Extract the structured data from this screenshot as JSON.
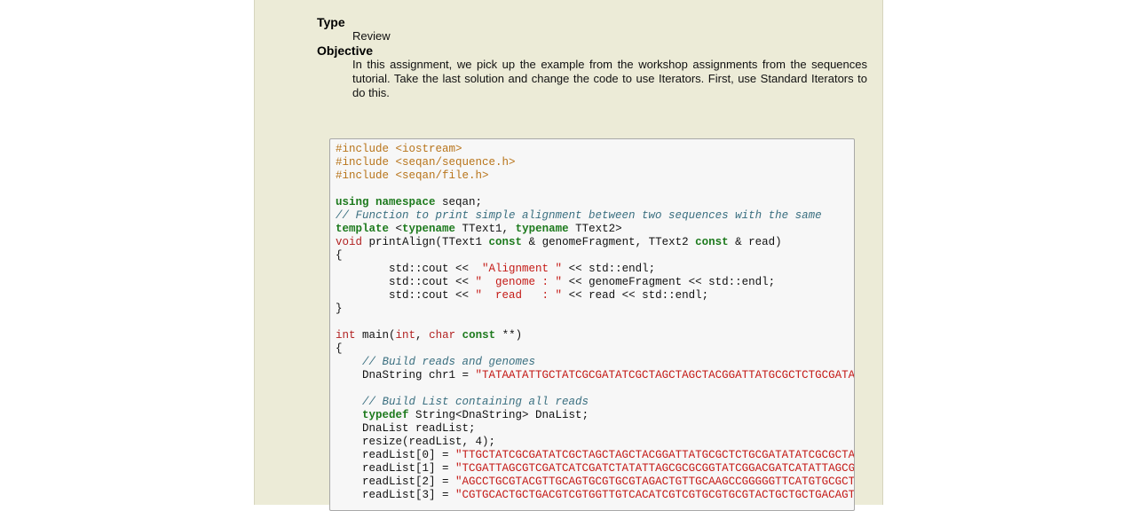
{
  "meta": {
    "type_label": "Type",
    "type_value": "Review",
    "objective_label": "Objective",
    "objective_text": "In this assignment, we pick up the example from the workshop assignments from the sequences tutorial. Take the last solution and change the code to use Iterators. First, use Standard Iterators to do this."
  },
  "code": {
    "lines": [
      [
        {
          "c": "pp",
          "t": "#include <iostream>"
        }
      ],
      [
        {
          "c": "pp",
          "t": "#include <seqan/sequence.h>"
        }
      ],
      [
        {
          "c": "pp",
          "t": "#include <seqan/file.h>"
        }
      ],
      [],
      [
        {
          "c": "kw",
          "t": "using"
        },
        {
          "c": "",
          "t": " "
        },
        {
          "c": "kw",
          "t": "namespace"
        },
        {
          "c": "",
          "t": " seqan;"
        }
      ],
      [
        {
          "c": "cm",
          "t": "// Function to print simple alignment between two sequences with the same"
        }
      ],
      [
        {
          "c": "kw",
          "t": "template"
        },
        {
          "c": "",
          "t": " <"
        },
        {
          "c": "kw",
          "t": "typename"
        },
        {
          "c": "",
          "t": " TText1, "
        },
        {
          "c": "kw",
          "t": "typename"
        },
        {
          "c": "",
          "t": " TText2>"
        }
      ],
      [
        {
          "c": "ty",
          "t": "void"
        },
        {
          "c": "",
          "t": " printAlign(TText1 "
        },
        {
          "c": "kw",
          "t": "const"
        },
        {
          "c": "",
          "t": " & genomeFragment, TText2 "
        },
        {
          "c": "kw",
          "t": "const"
        },
        {
          "c": "",
          "t": " & read)"
        }
      ],
      [
        {
          "c": "",
          "t": "{"
        }
      ],
      [
        {
          "c": "",
          "t": "        std::cout << "
        },
        {
          "c": "st",
          "t": " \"Alignment \""
        },
        {
          "c": "",
          "t": " << std::endl;"
        }
      ],
      [
        {
          "c": "",
          "t": "        std::cout << "
        },
        {
          "c": "st",
          "t": "\"  genome : \""
        },
        {
          "c": "",
          "t": " << genomeFragment << std::endl;"
        }
      ],
      [
        {
          "c": "",
          "t": "        std::cout << "
        },
        {
          "c": "st",
          "t": "\"  read   : \""
        },
        {
          "c": "",
          "t": " << read << std::endl;"
        }
      ],
      [
        {
          "c": "",
          "t": "}"
        }
      ],
      [],
      [
        {
          "c": "ty",
          "t": "int"
        },
        {
          "c": "",
          "t": " main("
        },
        {
          "c": "ty",
          "t": "int"
        },
        {
          "c": "",
          "t": ", "
        },
        {
          "c": "ty",
          "t": "char"
        },
        {
          "c": "",
          "t": " "
        },
        {
          "c": "kw",
          "t": "const"
        },
        {
          "c": "",
          "t": " **)"
        }
      ],
      [
        {
          "c": "",
          "t": "{"
        }
      ],
      [
        {
          "c": "",
          "t": "    "
        },
        {
          "c": "cm",
          "t": "// Build reads and genomes"
        }
      ],
      [
        {
          "c": "",
          "t": "    DnaString chr1 = "
        },
        {
          "c": "st",
          "t": "\"TATAATATTGCTATCGCGATATCGCTAGCTAGCTACGGATTATGCGCTCTGCGATATATCGCGC"
        }
      ],
      [],
      [
        {
          "c": "",
          "t": "    "
        },
        {
          "c": "cm",
          "t": "// Build List containing all reads"
        }
      ],
      [
        {
          "c": "",
          "t": "    "
        },
        {
          "c": "kw",
          "t": "typedef"
        },
        {
          "c": "",
          "t": " String<DnaString> DnaList;"
        }
      ],
      [
        {
          "c": "",
          "t": "    DnaList readList;"
        }
      ],
      [
        {
          "c": "",
          "t": "    resize(readList, 4);"
        }
      ],
      [
        {
          "c": "",
          "t": "    readList[0] = "
        },
        {
          "c": "st",
          "t": "\"TTGCTATCGCGATATCGCTAGCTAGCTACGGATTATGCGCTCTGCGATATATCGCGCTAGATG"
        }
      ],
      [
        {
          "c": "",
          "t": "    readList[1] = "
        },
        {
          "c": "st",
          "t": "\"TCGATTAGCGTCGATCATCGATCTATATTAGCGCGCGGTATCGGACGATCATATTAGCGGTCT"
        }
      ],
      [
        {
          "c": "",
          "t": "    readList[2] = "
        },
        {
          "c": "st",
          "t": "\"AGCCTGCGTACGTTGCAGTGCGTGCGTAGACTGTTGCAAGCCGGGGGTTCATGTGCGCTGAAG"
        }
      ],
      [
        {
          "c": "",
          "t": "    readList[3] = "
        },
        {
          "c": "st",
          "t": "\"CGTGCACTGCTGACGTCGTGGTTGTCACATCGTCGTGCGTGCGTACTGCTGCTGACAGTCGCA"
        }
      ]
    ]
  }
}
